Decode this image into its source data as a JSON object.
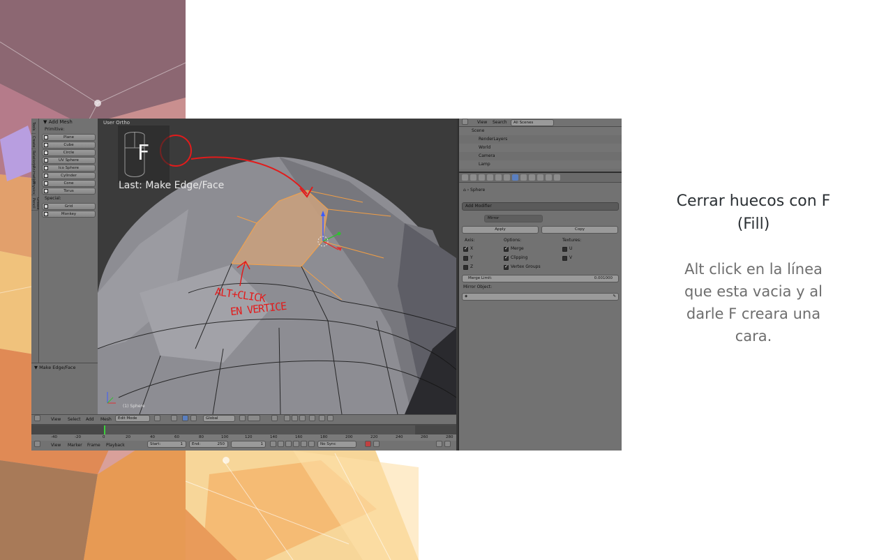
{
  "slide": {
    "title_line1": "Cerrar huecos con F",
    "title_line2": "(Fill)",
    "body_lines": [
      "Alt click en la línea",
      "que esta vacia y al",
      "darle F creara una",
      "cara."
    ]
  },
  "viewport": {
    "label": "User Ortho",
    "key_letter": "F",
    "last_operation": "Last: Make Edge/Face",
    "object_name": "(1) Sphere",
    "handwritten_1": "ALT+CLICK",
    "handwritten_2": "EN VERTICE"
  },
  "tool_shelf": {
    "tabs": [
      "Tools",
      "Create",
      "Relations",
      "Animation",
      "Physics",
      "Grease Pencil"
    ],
    "panel_title": "▼ Add Mesh",
    "section_primitives": "Primitive:",
    "primitives": [
      "Plane",
      "Cube",
      "Circle",
      "UV Sphere",
      "Ico Sphere",
      "Cylinder",
      "Cone",
      "Torus"
    ],
    "section_special": "Special:",
    "specials": [
      "Grid",
      "Monkey"
    ],
    "redo_panel_title": "▼ Make Edge/Face"
  },
  "viewport_header": {
    "menus": [
      "View",
      "Select",
      "Add",
      "Mesh"
    ],
    "mode": "Edit Mode",
    "pivot": "Global"
  },
  "timeline": {
    "ruler": [
      "-40",
      "-20",
      "0",
      "20",
      "40",
      "60",
      "80",
      "100",
      "120",
      "140",
      "160",
      "180",
      "200",
      "220",
      "240",
      "260",
      "280"
    ],
    "menus": [
      "View",
      "Marker",
      "Frame",
      "Playback"
    ],
    "start_label": "Start:",
    "start_value": "1",
    "end_label": "End:",
    "end_value": "250",
    "current_frame": "1",
    "sync": "No Sync"
  },
  "outliner": {
    "menus": [
      "View",
      "Search"
    ],
    "filter": "All Scenes",
    "rows": [
      "Scene",
      "RenderLayers",
      "World",
      "Camera",
      "Lamp",
      "Sphere"
    ]
  },
  "properties": {
    "breadcrumb": "Sphere",
    "add_modifier": "Add Modifier",
    "modifier_name": "Mirror",
    "apply": "Apply",
    "copy": "Copy",
    "axis_label": "Axis:",
    "options_label": "Options:",
    "textures_label": "Textures:",
    "axis": [
      "X",
      "Y",
      "Z"
    ],
    "options": [
      "Merge",
      "Clipping",
      "Vertex Groups"
    ],
    "textures": [
      "U",
      "V"
    ],
    "merge_limit_label": "Merge Limit:",
    "merge_limit_value": "0.001000",
    "mirror_object_label": "Mirror Object:"
  },
  "colors": {
    "selection": "#ffa340",
    "annotation": "#e21b1b",
    "mesh": "#8f8f95"
  }
}
